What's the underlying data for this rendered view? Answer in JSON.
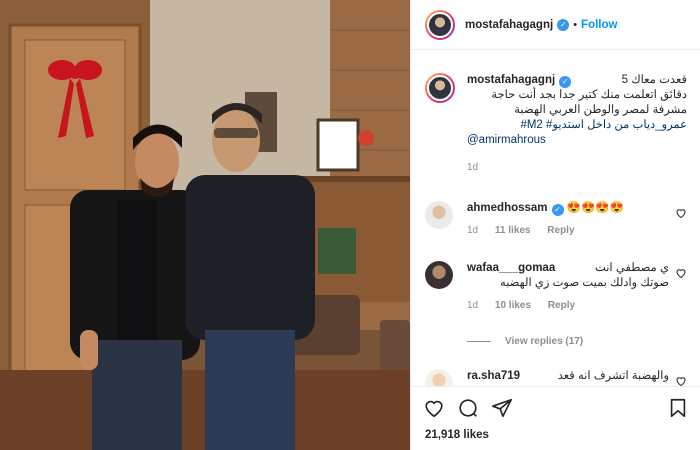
{
  "post": {
    "username": "mostafahagagnj",
    "follow_label": "Follow",
    "caption_lines": [
      "قعدت معاك 5",
      "دقائق اتعلمت منك كتير جدا بجد أنت حاجة",
      "مشرفة لمصر والوطن العربي الهضبة",
      "#M2 #عمرو_دياب من داخل استديو",
      "@amirmahrous"
    ],
    "caption_time": "1d",
    "likes": "21,918 likes"
  },
  "comments": [
    {
      "username": "ahmedhossam",
      "text": "😍😍😍😍",
      "time": "1d",
      "likes": "11 likes",
      "reply": "Reply",
      "verified": true
    },
    {
      "username": "wafaa___gomaa",
      "text_line1": "ي مصطفي انت",
      "text_line2": "صوتك وادلك بميت صوت زي الهضبه",
      "time": "1d",
      "likes": "10 likes",
      "reply": "Reply"
    },
    {
      "username": "ra.sha719",
      "text": "والهضبة اتشرف انه قعد"
    }
  ],
  "view_replies": "View replies (17)",
  "icons": [
    "heart-icon",
    "comment-icon",
    "share-icon",
    "bookmark-icon"
  ],
  "colors": {
    "accent": "#0095f6",
    "verified": "#3897f0",
    "muted": "#8e8e8e"
  }
}
